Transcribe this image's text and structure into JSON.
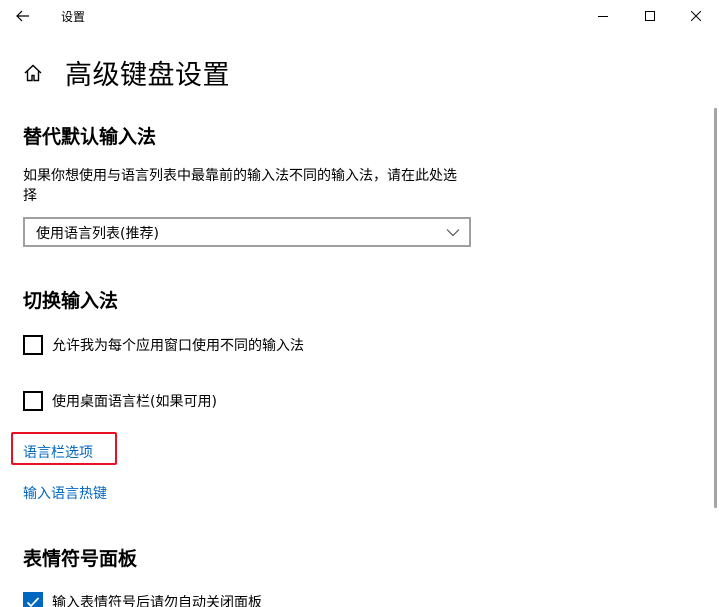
{
  "window": {
    "title": "设置",
    "back_icon": "arrow-left-icon",
    "controls": [
      "minimize-icon",
      "maximize-icon",
      "close-icon"
    ]
  },
  "page": {
    "title": "高级键盘设置",
    "home_icon": "home-icon"
  },
  "override_input": {
    "title": "替代默认输入法",
    "description": "如果你想使用与语言列表中最靠前的输入法不同的输入法，请在此处选择",
    "select_value": "使用语言列表(推荐)"
  },
  "switch_input": {
    "title": "切换输入法",
    "checkboxes": [
      {
        "label": "允许我为每个应用窗口使用不同的输入法",
        "checked": false
      },
      {
        "label": "使用桌面语言栏(如果可用)",
        "checked": false
      }
    ],
    "links": {
      "language_bar_options": "语言栏选项",
      "input_language_hotkeys": "输入语言热键"
    }
  },
  "emoji_panel": {
    "title": "表情符号面板",
    "checkbox": {
      "label": "输入表情符号后请勿自动关闭面板",
      "checked": true
    }
  },
  "colors": {
    "accent": "#0067c0",
    "highlight": "#e81123"
  }
}
